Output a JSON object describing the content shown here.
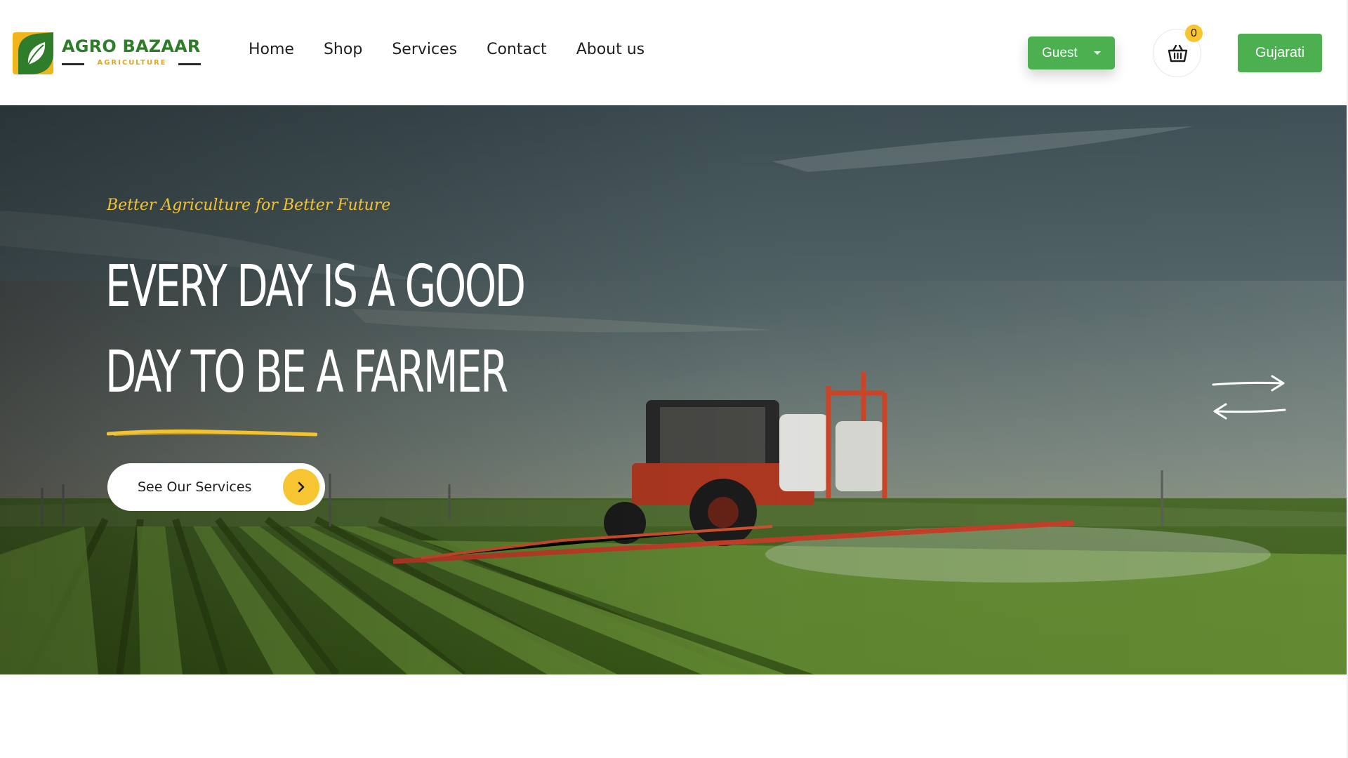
{
  "header": {
    "logo": {
      "brand": "AGRO BAZAAR",
      "tagline": "AGRICULTURE"
    },
    "nav": [
      {
        "label": "Home"
      },
      {
        "label": "Shop"
      },
      {
        "label": "Services"
      },
      {
        "label": "Contact"
      },
      {
        "label": "About us"
      }
    ],
    "user_dropdown": {
      "label": "Guest"
    },
    "cart": {
      "count": "0",
      "icon": "basket-icon"
    },
    "language_button": {
      "label": "Gujarati"
    }
  },
  "hero": {
    "tagline": "Better Agriculture for Better Future",
    "headline_line1": "Every Day Is A Good",
    "headline_line2": "Day To Be A Farmer",
    "cta": {
      "label": "See Our Services",
      "icon": "chevron-right-icon"
    },
    "slider_controls": {
      "next_icon": "arrow-right-icon",
      "prev_icon": "arrow-left-icon"
    }
  },
  "colors": {
    "brand_green": "#2f7d2a",
    "button_green": "#4caf50",
    "accent_yellow": "#f7c531",
    "tagline_yellow": "#f1c232"
  }
}
